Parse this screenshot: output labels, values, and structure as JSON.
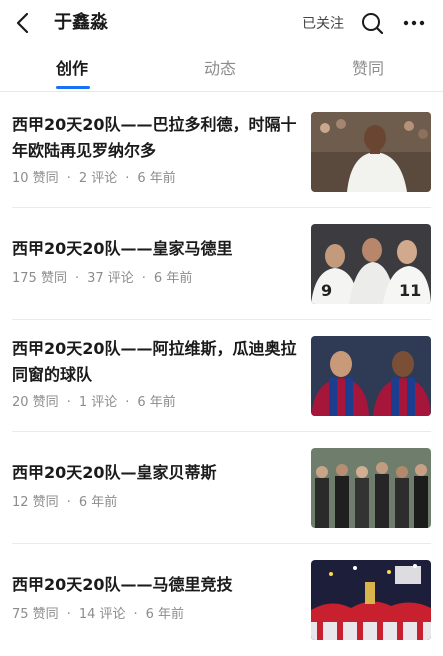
{
  "header": {
    "title": "于鑫淼",
    "follow_label": "已关注"
  },
  "icons": [
    "back-arrow-icon",
    "search-icon",
    "more-dots-icon"
  ],
  "tabs": [
    {
      "label": "创作",
      "active": true
    },
    {
      "label": "动态",
      "active": false
    },
    {
      "label": "赞同",
      "active": false
    }
  ],
  "accent_color": "#1772f6",
  "articles": [
    {
      "title": "西甲20天20队——巴拉多利德，时隔十年欧陆再见罗纳尔多",
      "likes": "10 赞同",
      "comments": "2 评论",
      "time": "6 年前"
    },
    {
      "title": "西甲20天20队——皇家马德里",
      "likes": "175 赞同",
      "comments": "37 评论",
      "time": "6 年前"
    },
    {
      "title": "西甲20天20队——阿拉维斯，瓜迪奥拉同窗的球队",
      "likes": "20 赞同",
      "comments": "1 评论",
      "time": "6 年前"
    },
    {
      "title": "西甲20天20队—皇家贝蒂斯",
      "likes": "12 赞同",
      "comments": "",
      "time": "6 年前"
    },
    {
      "title": "西甲20天20队——马德里竞技",
      "likes": "75 赞同",
      "comments": "14 评论",
      "time": "6 年前"
    }
  ]
}
